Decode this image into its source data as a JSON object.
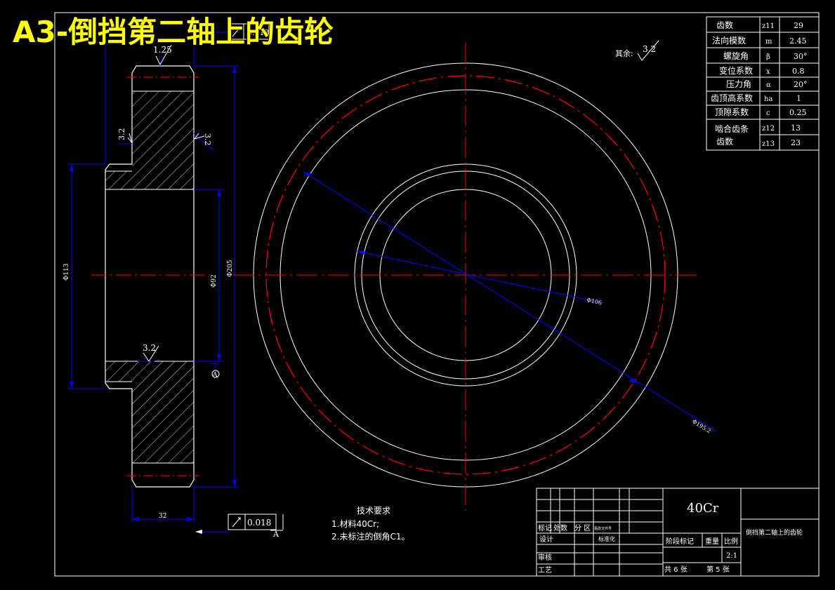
{
  "title": "A3-倒挡第二轴上的齿轮",
  "side_view": {
    "roughness_top": "1.25",
    "tolerance_top": "0.018",
    "roughness_left": "3.2",
    "roughness_right": "3.2",
    "roughness_bottom": "3.2",
    "datum_label": "A",
    "dim_left_outer": "Φ113",
    "dim_bore": "Φ92",
    "dim_outer": "Φ205",
    "dim_width": "32",
    "tolerance_bottom": "0.018",
    "tolerance_datum": "A"
  },
  "other_roughness": {
    "label": "其余:",
    "value": "3.2"
  },
  "front_view": {
    "dim_inner": "Φ106",
    "dim_outer": "Φ195.2"
  },
  "tech_requirements": {
    "heading": "技术要求",
    "items": [
      "1.材料40Cr;",
      "2.未标注的倒角C1。"
    ]
  },
  "params": [
    {
      "label": "齿数",
      "symbol": "z11",
      "value": "29"
    },
    {
      "label": "法向模数",
      "symbol": "m",
      "value": "2.45"
    },
    {
      "label": "螺旋角",
      "symbol": "β",
      "value": "30°"
    },
    {
      "label": "变位系数",
      "symbol": "x",
      "value": "0.8"
    },
    {
      "label": "压力角",
      "symbol": "α",
      "value": "20°"
    },
    {
      "label": "齿顶高系数",
      "symbol": "ha",
      "value": "1"
    },
    {
      "label": "顶隙系数",
      "symbol": "c",
      "value": "0.25"
    }
  ],
  "mesh_gears": {
    "label_line1": "啮合齿条",
    "label_line2": "齿数",
    "rows": [
      {
        "symbol": "z12",
        "value": "13"
      },
      {
        "symbol": "z13",
        "value": "23"
      }
    ]
  },
  "title_block": {
    "material": "40Cr",
    "drawing_name": "倒挡第二轴上的齿轮",
    "mark": "标记",
    "count": "处数",
    "zone": "分 区",
    "change_doc": "更改文件号",
    "design": "设计",
    "standardize": "标准化",
    "stage_mark": "阶段标记",
    "weight": "重量",
    "scale_label": "比例",
    "scale": "2:1",
    "review": "审核",
    "process": "工艺",
    "total": "共 6 张",
    "sheet": "第 5 张"
  },
  "colors": {
    "line": "#ffffff",
    "dimension": "#0000ff",
    "center": "#ff0000",
    "title": "#ffff00"
  }
}
